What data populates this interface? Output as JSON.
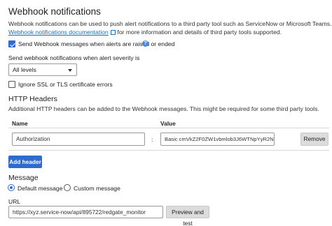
{
  "section": {
    "title": "Webhook notifications",
    "description_line1": "Webhook notifications can be used to push alert notifications to a third party tool such as ServiceNow or Microsoft Teams. See",
    "doc_link": "Webhook notifications documentation",
    "description_line2_rest": "for more information and details of third party tools supported.",
    "send_checkbox_label": "Send Webhook messages when alerts are raised or ended",
    "send_checkbox_checked": true
  },
  "severity": {
    "label": "Send webhook notifications when alert severity is",
    "selected": "All levels"
  },
  "ssl": {
    "label": "Ignore SSL or TLS certificate errors",
    "checked": false
  },
  "headers": {
    "title": "HTTP Headers",
    "description": "Additional HTTP headers can be added to the Webhook messages. This might be required for some third party tools.",
    "col_name": "Name",
    "col_value": "Value",
    "rows": [
      {
        "name": "Authorization",
        "separator": ":",
        "value": "Basic cmVkZ2F0ZW1vbmlob3J6WTNpYyR2Nif",
        "remove_label": "Remove"
      }
    ],
    "add_label": "Add header"
  },
  "message": {
    "title": "Message",
    "options": [
      {
        "label": "Default message",
        "selected": true
      },
      {
        "label": "Custom message",
        "selected": false
      }
    ]
  },
  "url": {
    "label": "URL",
    "value": "https://xyz.service-now/api/895722/redgate_monitor",
    "preview_label": "Preview and test"
  },
  "colors": {
    "accent": "#2d6bd1",
    "link": "#1a73b8"
  }
}
